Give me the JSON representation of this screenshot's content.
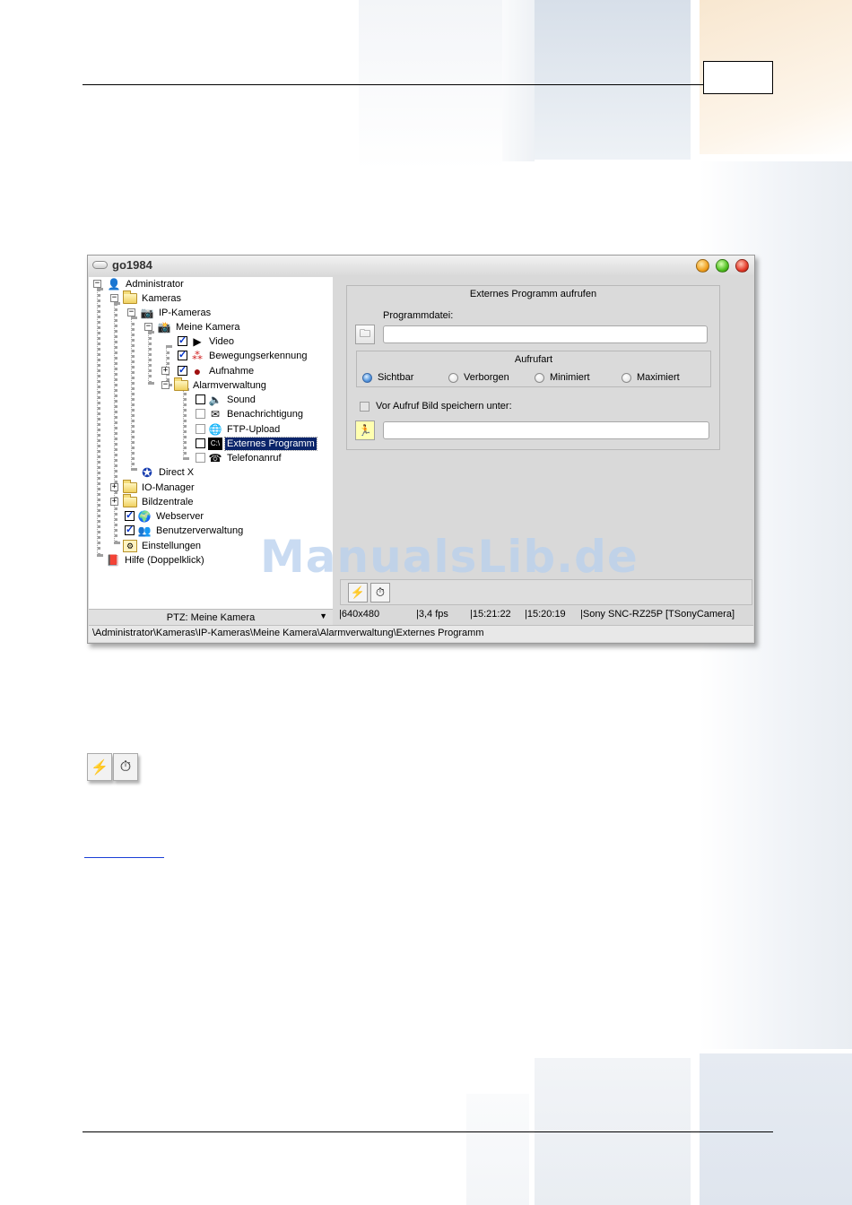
{
  "window": {
    "title": "go1984"
  },
  "tree": {
    "items": [
      {
        "label": "Administrator"
      },
      {
        "label": "Kameras"
      },
      {
        "label": "IP-Kameras"
      },
      {
        "label": "Meine Kamera"
      },
      {
        "label": "Video"
      },
      {
        "label": "Bewegungserkennung"
      },
      {
        "label": "Aufnahme"
      },
      {
        "label": "Alarmverwaltung"
      },
      {
        "label": "Sound"
      },
      {
        "label": "Benachrichtigung"
      },
      {
        "label": "FTP-Upload"
      },
      {
        "label": "Externes Programm"
      },
      {
        "label": "Telefonanruf"
      },
      {
        "label": "Direct X"
      },
      {
        "label": "IO-Manager"
      },
      {
        "label": "Bildzentrale"
      },
      {
        "label": "Webserver"
      },
      {
        "label": "Benutzerverwaltung"
      },
      {
        "label": "Einstellungen"
      },
      {
        "label": "Hilfe (Doppelklick)"
      }
    ]
  },
  "ptz": {
    "selected": "PTZ: Meine Kamera"
  },
  "panel": {
    "group_title": "Externes Programm aufrufen",
    "program_file_label": "Programmdatei:",
    "program_file_value": "",
    "call_mode_title": "Aufrufart",
    "modes": [
      "Sichtbar",
      "Verborgen",
      "Minimiert",
      "Maximiert"
    ],
    "selected_mode": "Sichtbar",
    "save_image_label": "Vor Aufruf Bild speichern unter:",
    "save_image_value": ""
  },
  "status": {
    "resolution": "640x480",
    "fps": "3,4 fps",
    "time1": "15:21:22",
    "time2": "15:20:19",
    "camera": "Sony SNC-RZ25P [TSonyCamera]"
  },
  "path": "\\Administrator\\Kameras\\IP-Kameras\\Meine Kamera\\Alarmverwaltung\\Externes Programm",
  "watermark": "ManualsLib.de",
  "colors": {
    "selection": "#0a246a",
    "window_bg": "#d9d9d9",
    "link": "#1a3fd6"
  }
}
